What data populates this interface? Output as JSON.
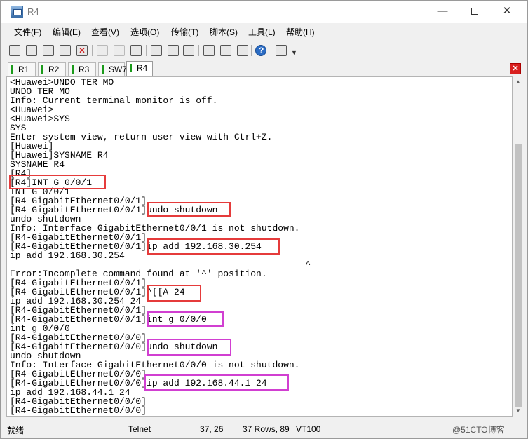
{
  "window": {
    "title": "R4"
  },
  "menu": [
    "文件(F)",
    "编辑(E)",
    "查看(V)",
    "选项(O)",
    "传输(T)",
    "脚本(S)",
    "工具(L)",
    "帮助(H)"
  ],
  "tabs": [
    "R1",
    "R2",
    "R3",
    "SW7",
    "R4"
  ],
  "active_tab": "R4",
  "terminal_lines": [
    "<Huawei>UNDO TER MO",
    "UNDO TER MO",
    "Info: Current terminal monitor is off.",
    "<Huawei>",
    "<Huawei>SYS",
    "SYS",
    "Enter system view, return user view with Ctrl+Z.",
    "[Huawei]",
    "[Huawei]SYSNAME R4",
    "SYSNAME R4",
    "[R4]",
    "[R4]INT G 0/0/1",
    "INT G 0/0/1",
    "[R4-GigabitEthernet0/0/1]",
    "[R4-GigabitEthernet0/0/1]undo shutdown",
    "undo shutdown",
    "Info: Interface GigabitEthernet0/0/1 is not shutdown.",
    "[R4-GigabitEthernet0/0/1]",
    "[R4-GigabitEthernet0/0/1]ip add 192.168.30.254",
    "ip add 192.168.30.254",
    "                                                      ^",
    "Error:Incomplete command found at '^' position.",
    "[R4-GigabitEthernet0/0/1]",
    "[R4-GigabitEthernet0/0/1]^[[A 24",
    "ip add 192.168.30.254 24",
    "[R4-GigabitEthernet0/0/1]",
    "[R4-GigabitEthernet0/0/1]int g 0/0/0",
    "int g 0/0/0",
    "[R4-GigabitEthernet0/0/0]",
    "[R4-GigabitEthernet0/0/0]undo shutdown",
    "undo shutdown",
    "Info: Interface GigabitEthernet0/0/0 is not shutdown.",
    "[R4-GigabitEthernet0/0/0]",
    "[R4-GigabitEthernet0/0/0]ip add 192.168.44.1 24",
    "ip add 192.168.44.1 24",
    "[R4-GigabitEthernet0/0/0]",
    "[R4-GigabitEthernet0/0/0]"
  ],
  "colors": {
    "red_highlight": "#e53b3b",
    "magenta_highlight": "#d13fd1",
    "tab_marker": "#1a9a1a"
  },
  "status": {
    "ready": "就绪",
    "protocol": "Telnet",
    "cursor": "37,  26",
    "rows": "37 Rows,  89",
    "emulation": "VT100",
    "watermark": "@51CTO博客"
  }
}
